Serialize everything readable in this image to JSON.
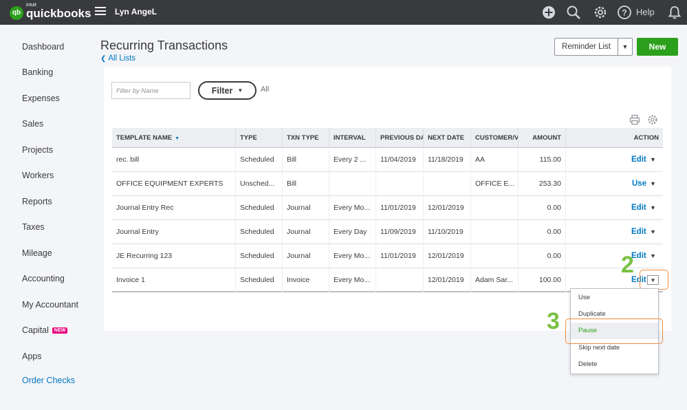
{
  "topbar": {
    "logo_intuit": "intuit",
    "logo_brand": "quickbooks",
    "logo_mark": "qb",
    "company_name": "Lyn AngeL",
    "help_label": "Help",
    "icons": [
      "hamburger-menu-icon",
      "plus-icon",
      "search-icon",
      "gear-icon",
      "help-icon",
      "bell-icon"
    ]
  },
  "sidebar": {
    "items": [
      {
        "label": "Dashboard"
      },
      {
        "label": "Banking"
      },
      {
        "label": "Expenses"
      },
      {
        "label": "Sales"
      },
      {
        "label": "Projects"
      },
      {
        "label": "Workers"
      },
      {
        "label": "Reports"
      },
      {
        "label": "Taxes"
      },
      {
        "label": "Mileage"
      },
      {
        "label": "Accounting"
      },
      {
        "label": "My Accountant"
      },
      {
        "label": "Capital",
        "badge": "NEW"
      },
      {
        "label": "Apps"
      },
      {
        "label": "Order Checks"
      }
    ]
  },
  "header": {
    "title": "Recurring Transactions",
    "back_link": "All Lists",
    "reminder_button": "Reminder List",
    "new_button": "New"
  },
  "filters": {
    "search_placeholder": "Filter by Name",
    "filter_button": "Filter",
    "filter_state": "All"
  },
  "table": {
    "columns": [
      "TEMPLATE NAME",
      "TYPE",
      "TXN TYPE",
      "INTERVAL",
      "PREVIOUS DA",
      "NEXT DATE",
      "CUSTOMER/V",
      "AMOUNT",
      "ACTION"
    ],
    "rows": [
      {
        "name": "rec. bill",
        "type": "Scheduled",
        "txn": "Bill",
        "interval": "Every 2 ...",
        "prev": "11/04/2019",
        "next": "11/18/2019",
        "customer": "AA",
        "amount": "115.00",
        "action": "Edit"
      },
      {
        "name": "OFFICE EQUIPMENT EXPERTS",
        "type": "Unsched...",
        "txn": "Bill",
        "interval": "",
        "prev": "",
        "next": "",
        "customer": "OFFICE E...",
        "amount": "253.30",
        "action": "Use"
      },
      {
        "name": "Journal Entry Rec",
        "type": "Scheduled",
        "txn": "Journal",
        "interval": "Every Mo...",
        "prev": "11/01/2019",
        "next": "12/01/2019",
        "customer": "",
        "amount": "0.00",
        "action": "Edit"
      },
      {
        "name": "Journal Entry",
        "type": "Scheduled",
        "txn": "Journal",
        "interval": "Every Day",
        "prev": "11/09/2019",
        "next": "11/10/2019",
        "customer": "",
        "amount": "0.00",
        "action": "Edit"
      },
      {
        "name": "JE Recurring 123",
        "type": "Scheduled",
        "txn": "Journal",
        "interval": "Every Mo...",
        "prev": "11/01/2019",
        "next": "12/01/2019",
        "customer": "",
        "amount": "0.00",
        "action": "Edit"
      },
      {
        "name": "Invoice 1",
        "type": "Scheduled",
        "txn": "Invoice",
        "interval": "Every Mo...",
        "prev": "",
        "next": "12/01/2019",
        "customer": "Adam Sar...",
        "amount": "100.00",
        "action": "Edit"
      }
    ]
  },
  "action_menu": {
    "items": [
      "Use",
      "Duplicate",
      "Pause",
      "Skip next date",
      "Delete"
    ],
    "highlighted": "Pause"
  },
  "annotations": {
    "step_2": "2",
    "step_3": "3",
    "box_color": "#f08a3c",
    "number_color": "#7ac143"
  },
  "colors": {
    "brand_green": "#2ca01c",
    "link_blue": "#0077c5",
    "topbar": "#393a3d"
  }
}
